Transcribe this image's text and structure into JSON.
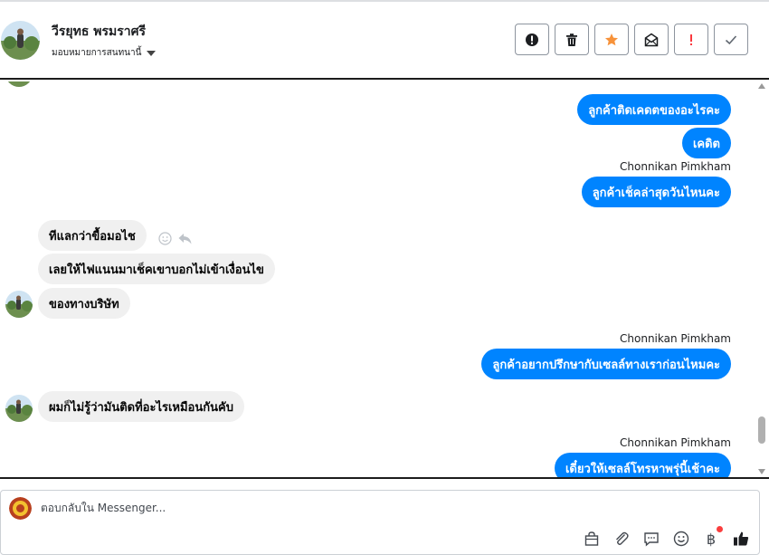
{
  "header": {
    "contact_name": "วีรยุทธ พรมราศรี",
    "assign_label": "มอบหมายการสนทนานี้",
    "actions": [
      {
        "name": "mark-spam-button",
        "icon": "alert-circle-icon"
      },
      {
        "name": "delete-button",
        "icon": "trash-icon"
      },
      {
        "name": "star-button",
        "icon": "star-icon",
        "color": "#f7923a"
      },
      {
        "name": "mark-unread-button",
        "icon": "envelope-icon"
      },
      {
        "name": "follow-up-button",
        "icon": "exclamation-icon",
        "color": "#fa383e"
      },
      {
        "name": "mark-done-button",
        "icon": "check-icon"
      }
    ]
  },
  "conversation": {
    "messages": [
      {
        "direction": "out",
        "text": "ลูกค้าติดเคดตของอะไรคะ"
      },
      {
        "direction": "out",
        "text": "เคดิต"
      },
      {
        "sender": "Chonnikan Pimkham"
      },
      {
        "direction": "out",
        "text": "ลูกค้าเช็คล่าสุดวันไหนคะ"
      },
      {
        "direction": "in",
        "text": "ทีแลกว่าขื้อมอไช"
      },
      {
        "direction": "in",
        "text": "เลยให้ไฟแนนมาเช็คเขาบอกไม่เข้าเงื่อนไข"
      },
      {
        "direction": "in",
        "text": "ของทางบริษัท"
      },
      {
        "sender": "Chonnikan Pimkham"
      },
      {
        "direction": "out",
        "text": "ลูกค้าอยากปรึกษากับเซลล์ทางเราก่อนไหมคะ"
      },
      {
        "direction": "in",
        "text": "ผมก็ไม่รู้ว่ามันติดที่อะไรเหมือนกันคับ"
      },
      {
        "sender": "Chonnikan Pimkham"
      },
      {
        "direction": "out",
        "text": "เดี๋ยวให้เซลล์โทรหาพรุ่นี้เช้าคะ"
      }
    ]
  },
  "composer": {
    "placeholder": "ตอบกลับใน Messenger...",
    "tools": [
      "bag-icon",
      "paperclip-icon",
      "quick-reply-icon",
      "emoji-icon",
      "baht-icon",
      "thumbs-up-icon"
    ],
    "baht_symbol": "฿"
  },
  "colors": {
    "outgoing_bubble": "#0084ff",
    "incoming_bubble": "#f0f0f0",
    "star": "#f7923a",
    "alert": "#fa383e"
  }
}
